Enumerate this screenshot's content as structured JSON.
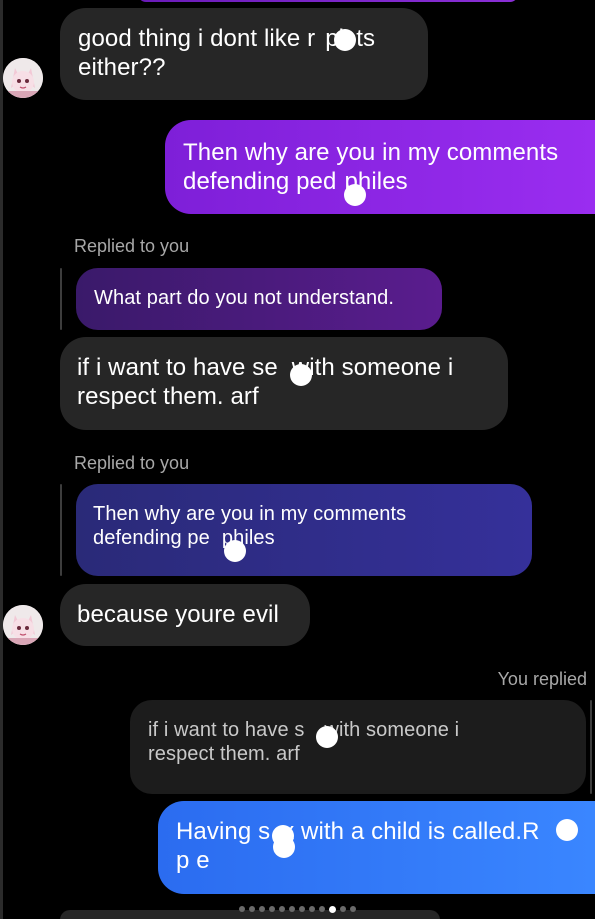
{
  "colors": {
    "incoming_bubble": "#262626",
    "outgoing_purple": "#8a2ae6",
    "outgoing_blue": "#3078f8",
    "label_gray": "#a8a8a8",
    "background": "#000000"
  },
  "messages": [
    {
      "id": "m1",
      "side": "incoming",
      "text_line1": "good thing i dont like r",
      "text_line1b": "pists",
      "text_line2": "either??"
    },
    {
      "id": "m2",
      "side": "outgoing",
      "text_line1": "Then why are you in my comments",
      "text_line2": "defending ped",
      "text_line2b": "philes"
    },
    {
      "id": "m3",
      "side": "incoming",
      "reply_label": "Replied to you",
      "quoted": "What part do you not understand.",
      "text_line1": "if i want to have se",
      "text_line1b": "with someone i",
      "text_line2": "respect them. arf"
    },
    {
      "id": "m4",
      "side": "incoming",
      "reply_label": "Replied to you",
      "quoted_line1": "Then why are you in my comments",
      "quoted_line2": "defending pe",
      "quoted_line2b": "philes",
      "text": "because youre evil"
    },
    {
      "id": "m5",
      "side": "outgoing",
      "reply_label": "You replied",
      "quoted_line1": "if i want to have s",
      "quoted_line1b": "with someone i",
      "quoted_line2": "respect them. arf",
      "text_line1a": "Having s",
      "text_line1b": "x with a child is called.R",
      "text_line2": "p e"
    }
  ],
  "avatar": {
    "icon": "avatar-anime-character"
  },
  "pagination": {
    "total": 12,
    "active_index": 9
  }
}
